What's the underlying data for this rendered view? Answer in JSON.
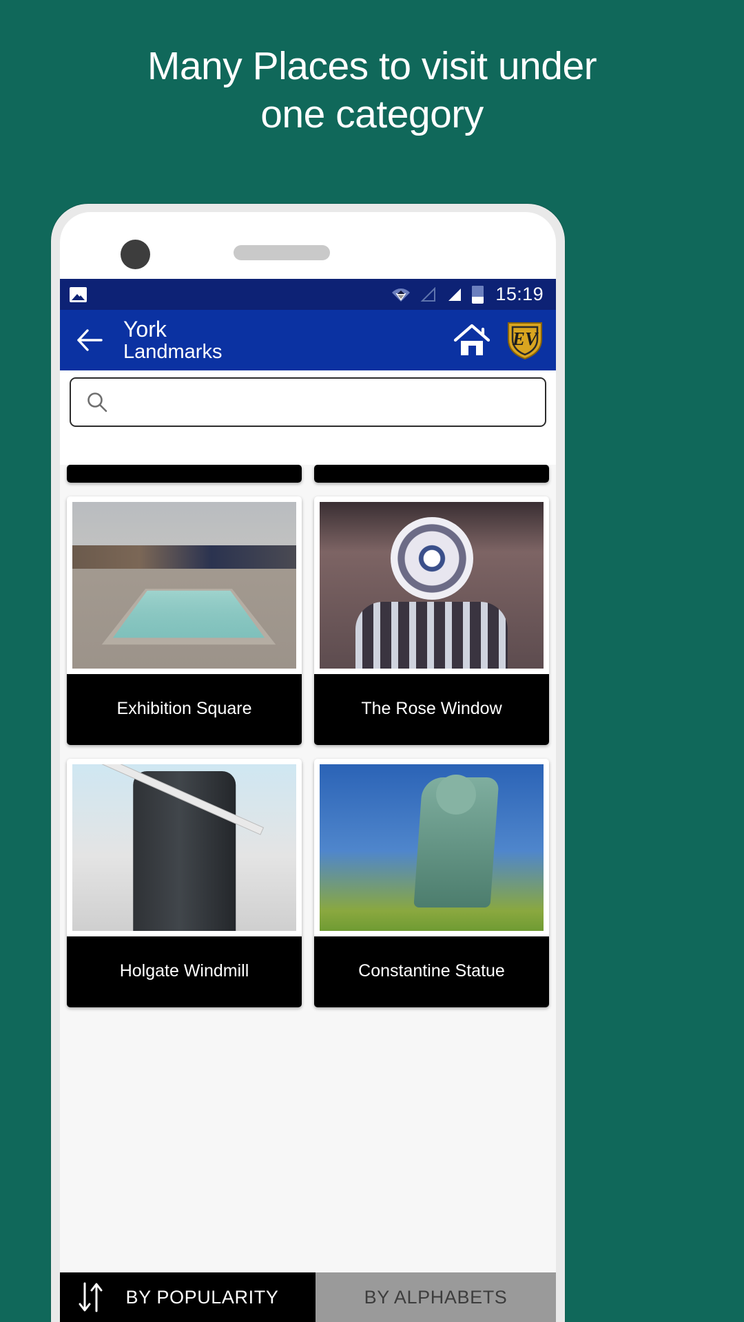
{
  "headline": "Many Places to visit under\none category",
  "colors": {
    "background": "#10685a",
    "statusbar": "#0d2275",
    "appbar": "#0b32a2",
    "caption": "#000000",
    "sort_active": "#000000",
    "sort_inactive": "#9a9a9a",
    "shield": "#d9a520"
  },
  "statusbar": {
    "photo_icon": "photo-icon",
    "wifi_icon": "wifi-icon",
    "signal_empty_icon": "signal-empty-icon",
    "signal_full_icon": "signal-full-icon",
    "battery_icon": "battery-icon",
    "time": "15:19"
  },
  "appbar": {
    "back_icon": "back-arrow-icon",
    "title": "York",
    "subtitle": "Landmarks",
    "home_icon": "home-icon",
    "logo_icon": "ev-shield-logo",
    "logo_text": "EV"
  },
  "search": {
    "icon": "search-icon",
    "value": "",
    "placeholder": ""
  },
  "grid": {
    "partial_row": [
      {
        "name": "partial-card-left"
      },
      {
        "name": "partial-card-right"
      }
    ],
    "cards": [
      {
        "caption": "Exhibition Square",
        "art": "ph-sq"
      },
      {
        "caption": "The Rose Window",
        "art": "ph-rose"
      },
      {
        "caption": "Holgate Windmill",
        "art": "ph-mill"
      },
      {
        "caption": "Constantine Statue",
        "art": "ph-stat"
      }
    ]
  },
  "sortbar": {
    "sort_icon": "sort-arrows-icon",
    "by_popularity": "BY POPULARITY",
    "by_alphabets": "BY ALPHABETS"
  }
}
